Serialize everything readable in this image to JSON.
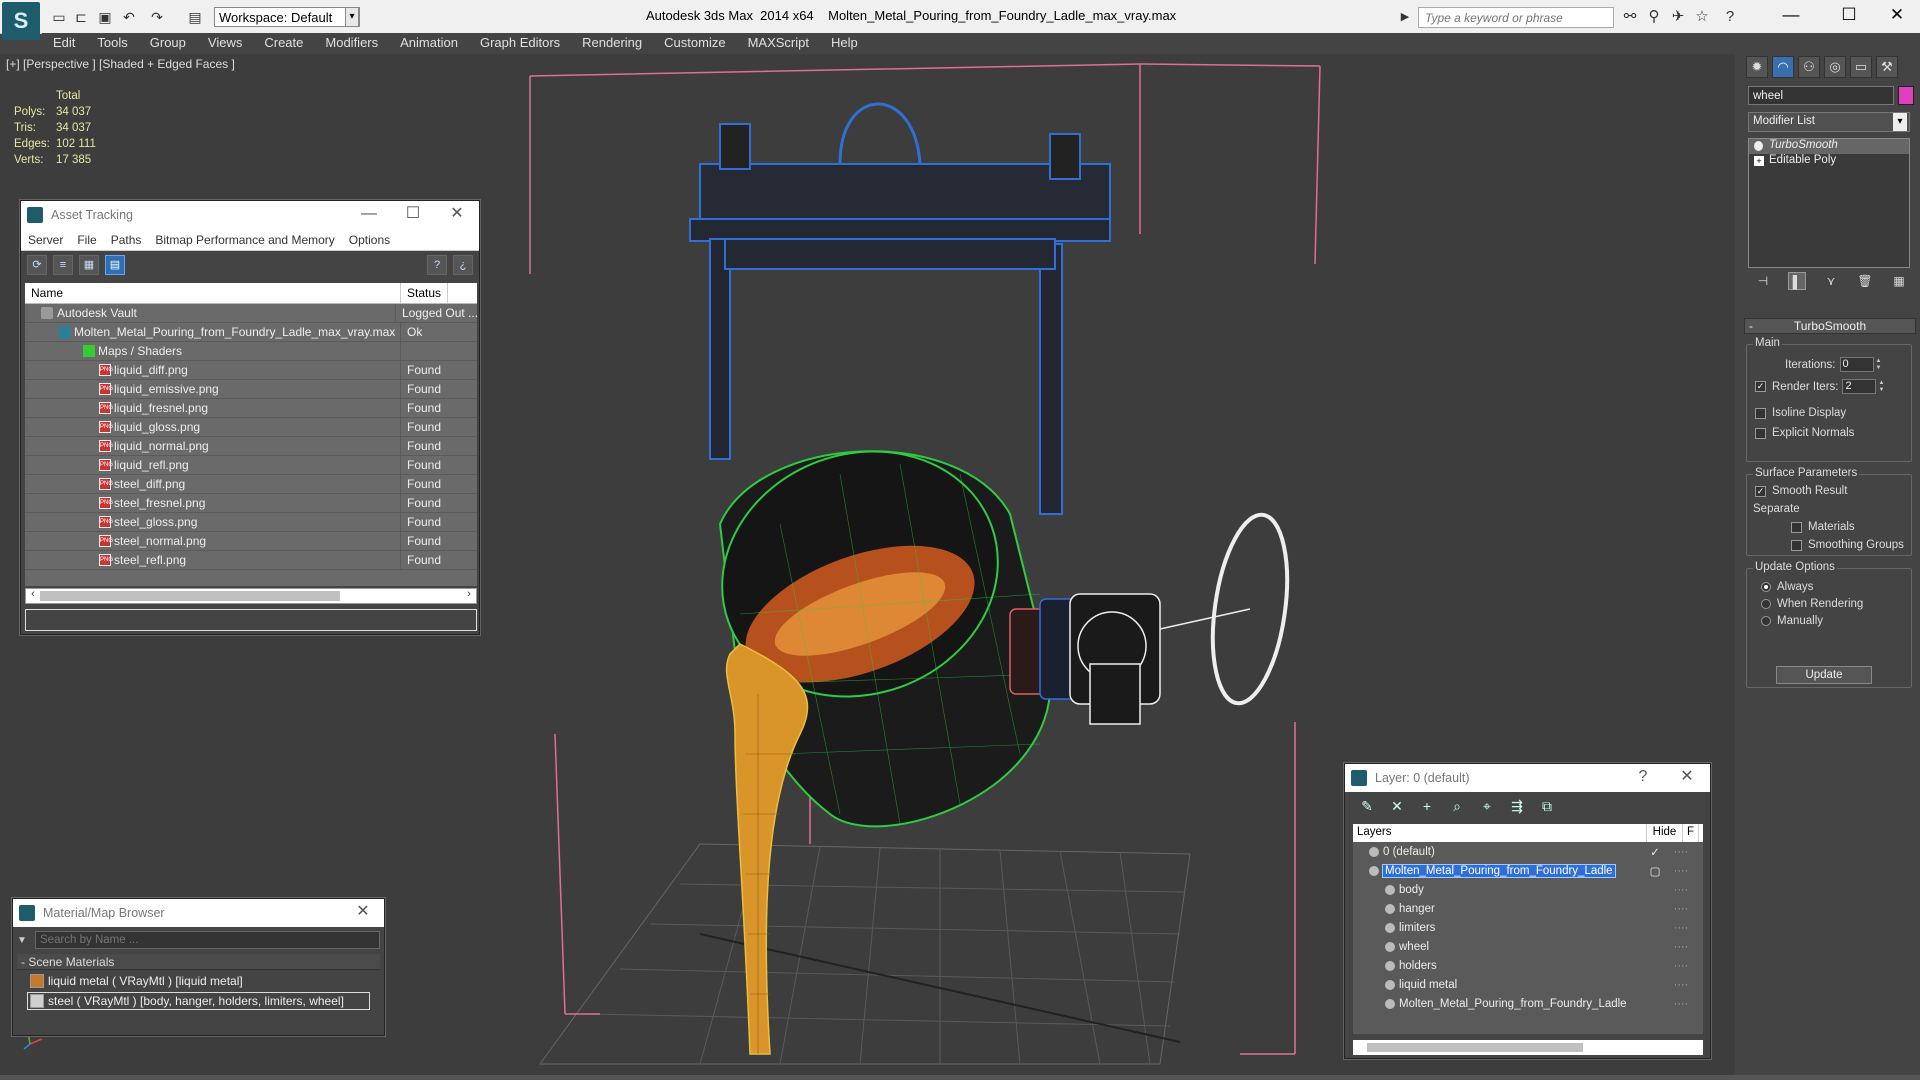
{
  "titlebar": {
    "workspace": "Workspace: Default",
    "app_name": "Autodesk 3ds Max  2014 x64",
    "file_name": "Molten_Metal_Pouring_from_Foundry_Ladle_max_vray.max",
    "search_placeholder": "Type a keyword or phrase"
  },
  "menu": [
    "Edit",
    "Tools",
    "Group",
    "Views",
    "Create",
    "Modifiers",
    "Animation",
    "Graph Editors",
    "Rendering",
    "Customize",
    "MAXScript",
    "Help"
  ],
  "viewport": {
    "label": "[+] [Perspective ] [Shaded + Edged Faces ]",
    "stats": {
      "header": "Total",
      "rows": [
        {
          "k": "Polys:",
          "v": "34 037"
        },
        {
          "k": "Tris:",
          "v": "34 037"
        },
        {
          "k": "Edges:",
          "v": "102 111"
        },
        {
          "k": "Verts:",
          "v": "17 385"
        }
      ]
    }
  },
  "asset_tracking": {
    "title": "Asset Tracking",
    "menu": [
      "Server",
      "File",
      "Paths",
      "Bitmap Performance and Memory",
      "Options"
    ],
    "columns": [
      "Name",
      "Status"
    ],
    "rows": [
      {
        "name": "Autodesk Vault",
        "status": "Logged Out ...",
        "kind": "vault",
        "indent": 16
      },
      {
        "name": "Molten_Metal_Pouring_from_Foundry_Ladle_max_vray.max",
        "status": "Ok",
        "kind": "max",
        "indent": 34
      },
      {
        "name": "Maps / Shaders",
        "status": "",
        "kind": "maps",
        "indent": 58
      },
      {
        "name": "liquid_diff.png",
        "status": "Found",
        "kind": "png",
        "indent": 74
      },
      {
        "name": "liquid_emissive.png",
        "status": "Found",
        "kind": "png",
        "indent": 74
      },
      {
        "name": "liquid_fresnel.png",
        "status": "Found",
        "kind": "png",
        "indent": 74
      },
      {
        "name": "liquid_gloss.png",
        "status": "Found",
        "kind": "png",
        "indent": 74
      },
      {
        "name": "liquid_normal.png",
        "status": "Found",
        "kind": "png",
        "indent": 74
      },
      {
        "name": "liquid_refl.png",
        "status": "Found",
        "kind": "png",
        "indent": 74
      },
      {
        "name": "steel_diff.png",
        "status": "Found",
        "kind": "png",
        "indent": 74
      },
      {
        "name": "steel_fresnel.png",
        "status": "Found",
        "kind": "png",
        "indent": 74
      },
      {
        "name": "steel_gloss.png",
        "status": "Found",
        "kind": "png",
        "indent": 74
      },
      {
        "name": "steel_normal.png",
        "status": "Found",
        "kind": "png",
        "indent": 74
      },
      {
        "name": "steel_refl.png",
        "status": "Found",
        "kind": "png",
        "indent": 74
      }
    ]
  },
  "material_browser": {
    "title": "Material/Map Browser",
    "search_placeholder": "Search by Name ...",
    "group": "- Scene Materials",
    "items": [
      {
        "label": "liquid metal  ( VRayMtl ) [liquid metal]",
        "swatch": "#c47a2a",
        "selected": false
      },
      {
        "label": "steel  ( VRayMtl ) [body, hanger, holders, limiters, wheel]",
        "swatch": "#cfcfcf",
        "selected": true
      }
    ]
  },
  "layers": {
    "title": "Layer: 0 (default)",
    "columns": [
      "Layers",
      "Hide",
      "F"
    ],
    "rows": [
      {
        "name": "0 (default)",
        "indent": 16,
        "sel": false,
        "mark": "✓"
      },
      {
        "name": "Molten_Metal_Pouring_from_Foundry_Ladle",
        "indent": 16,
        "sel": true,
        "mark": "▢"
      },
      {
        "name": "body",
        "indent": 32,
        "sel": false,
        "mark": ""
      },
      {
        "name": "hanger",
        "indent": 32,
        "sel": false,
        "mark": ""
      },
      {
        "name": "limiters",
        "indent": 32,
        "sel": false,
        "mark": ""
      },
      {
        "name": "wheel",
        "indent": 32,
        "sel": false,
        "mark": ""
      },
      {
        "name": "holders",
        "indent": 32,
        "sel": false,
        "mark": ""
      },
      {
        "name": "liquid metal",
        "indent": 32,
        "sel": false,
        "mark": ""
      },
      {
        "name": "Molten_Metal_Pouring_from_Foundry_Ladle",
        "indent": 32,
        "sel": false,
        "mark": ""
      }
    ]
  },
  "command_panel": {
    "object_name": "wheel",
    "object_color": "#e040c0",
    "modifier_list": "Modifier List",
    "stack": [
      {
        "label": "TurboSmooth",
        "sel": true,
        "ico": "bulb"
      },
      {
        "label": "Editable Poly",
        "sel": false,
        "ico": "plus"
      }
    ],
    "turbosmooth": {
      "title": "TurboSmooth",
      "main_label": "Main",
      "iterations_label": "Iterations:",
      "iterations_value": "0",
      "render_iters_label": "Render Iters:",
      "render_iters_value": "2",
      "isoline_label": "Isoline Display",
      "explicit_label": "Explicit Normals",
      "surface_label": "Surface Parameters",
      "smooth_result_label": "Smooth Result",
      "separate_label": "Separate",
      "materials_label": "Materials",
      "smoothing_groups_label": "Smoothing Groups",
      "update_options_label": "Update Options",
      "always_label": "Always",
      "when_rendering_label": "When Rendering",
      "manually_label": "Manually",
      "update_button": "Update"
    }
  }
}
